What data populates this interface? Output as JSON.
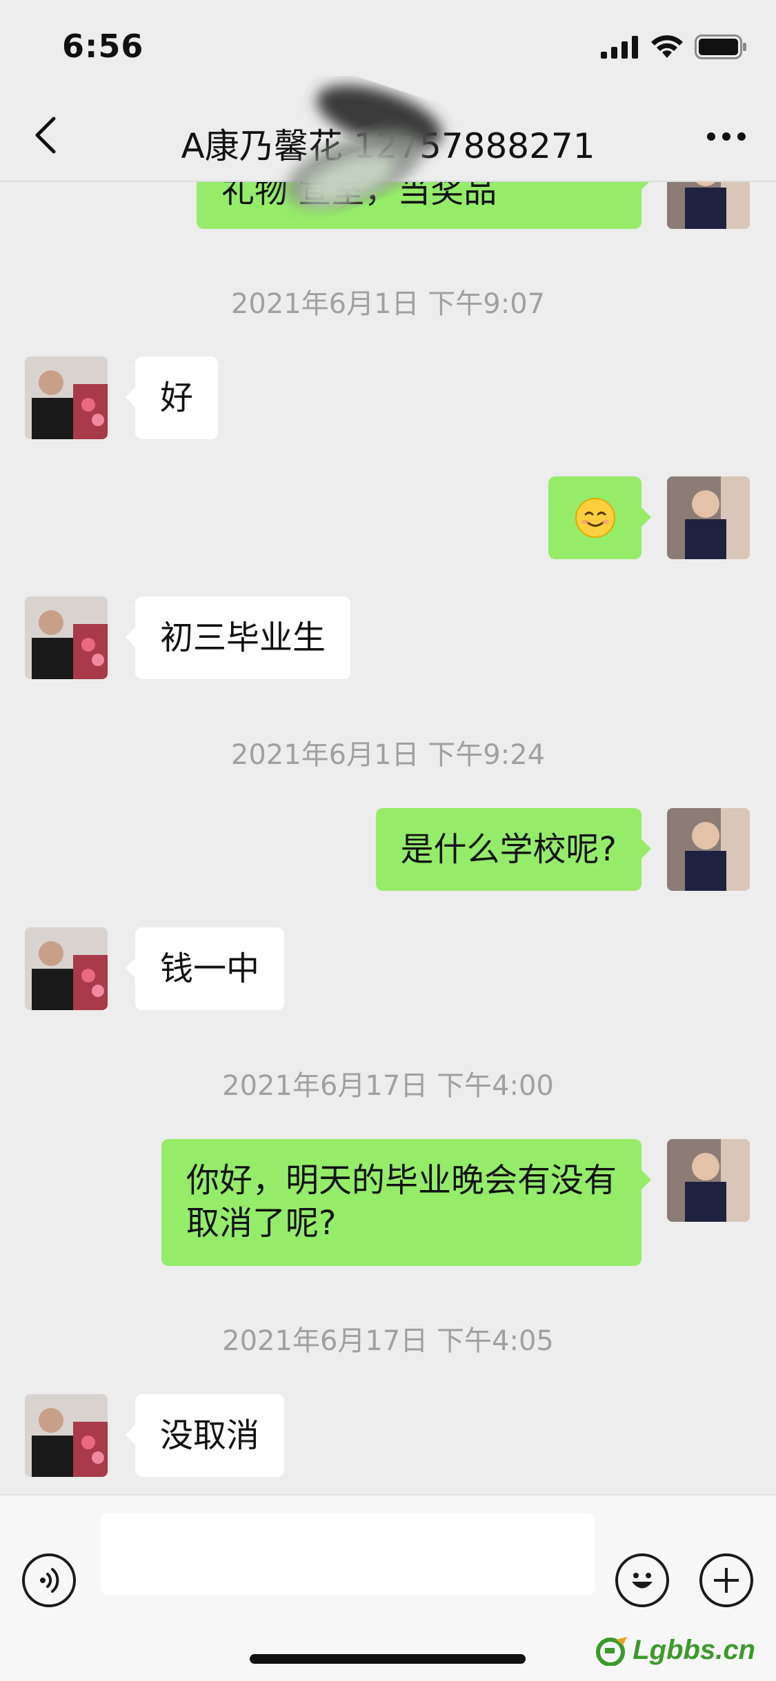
{
  "status_bar": {
    "time": "6:56"
  },
  "nav": {
    "title": "A康乃馨花   12757888271"
  },
  "messages": {
    "partial_top": "礼物          宣室，当奖品",
    "ts1": "2021年6月1日 下午9:07",
    "m1": "好",
    "m2_emoji": "😊",
    "m3": "初三毕业生",
    "ts2": "2021年6月1日 下午9:24",
    "m4": "是什么学校呢?",
    "m5": "钱一中",
    "ts3": "2021年6月17日 下午4:00",
    "m6_line1": "你好，明天的毕业晚会有没有",
    "m6_line2": "取消了呢?",
    "ts4": "2021年6月17日 下午4:05",
    "m7": "没取消"
  },
  "input": {
    "placeholder": ""
  },
  "watermark": {
    "text": "Lgbbs.cn"
  },
  "colors": {
    "outgoing_bubble": "#95ec69",
    "incoming_bubble": "#ffffff",
    "background": "#ededed"
  }
}
